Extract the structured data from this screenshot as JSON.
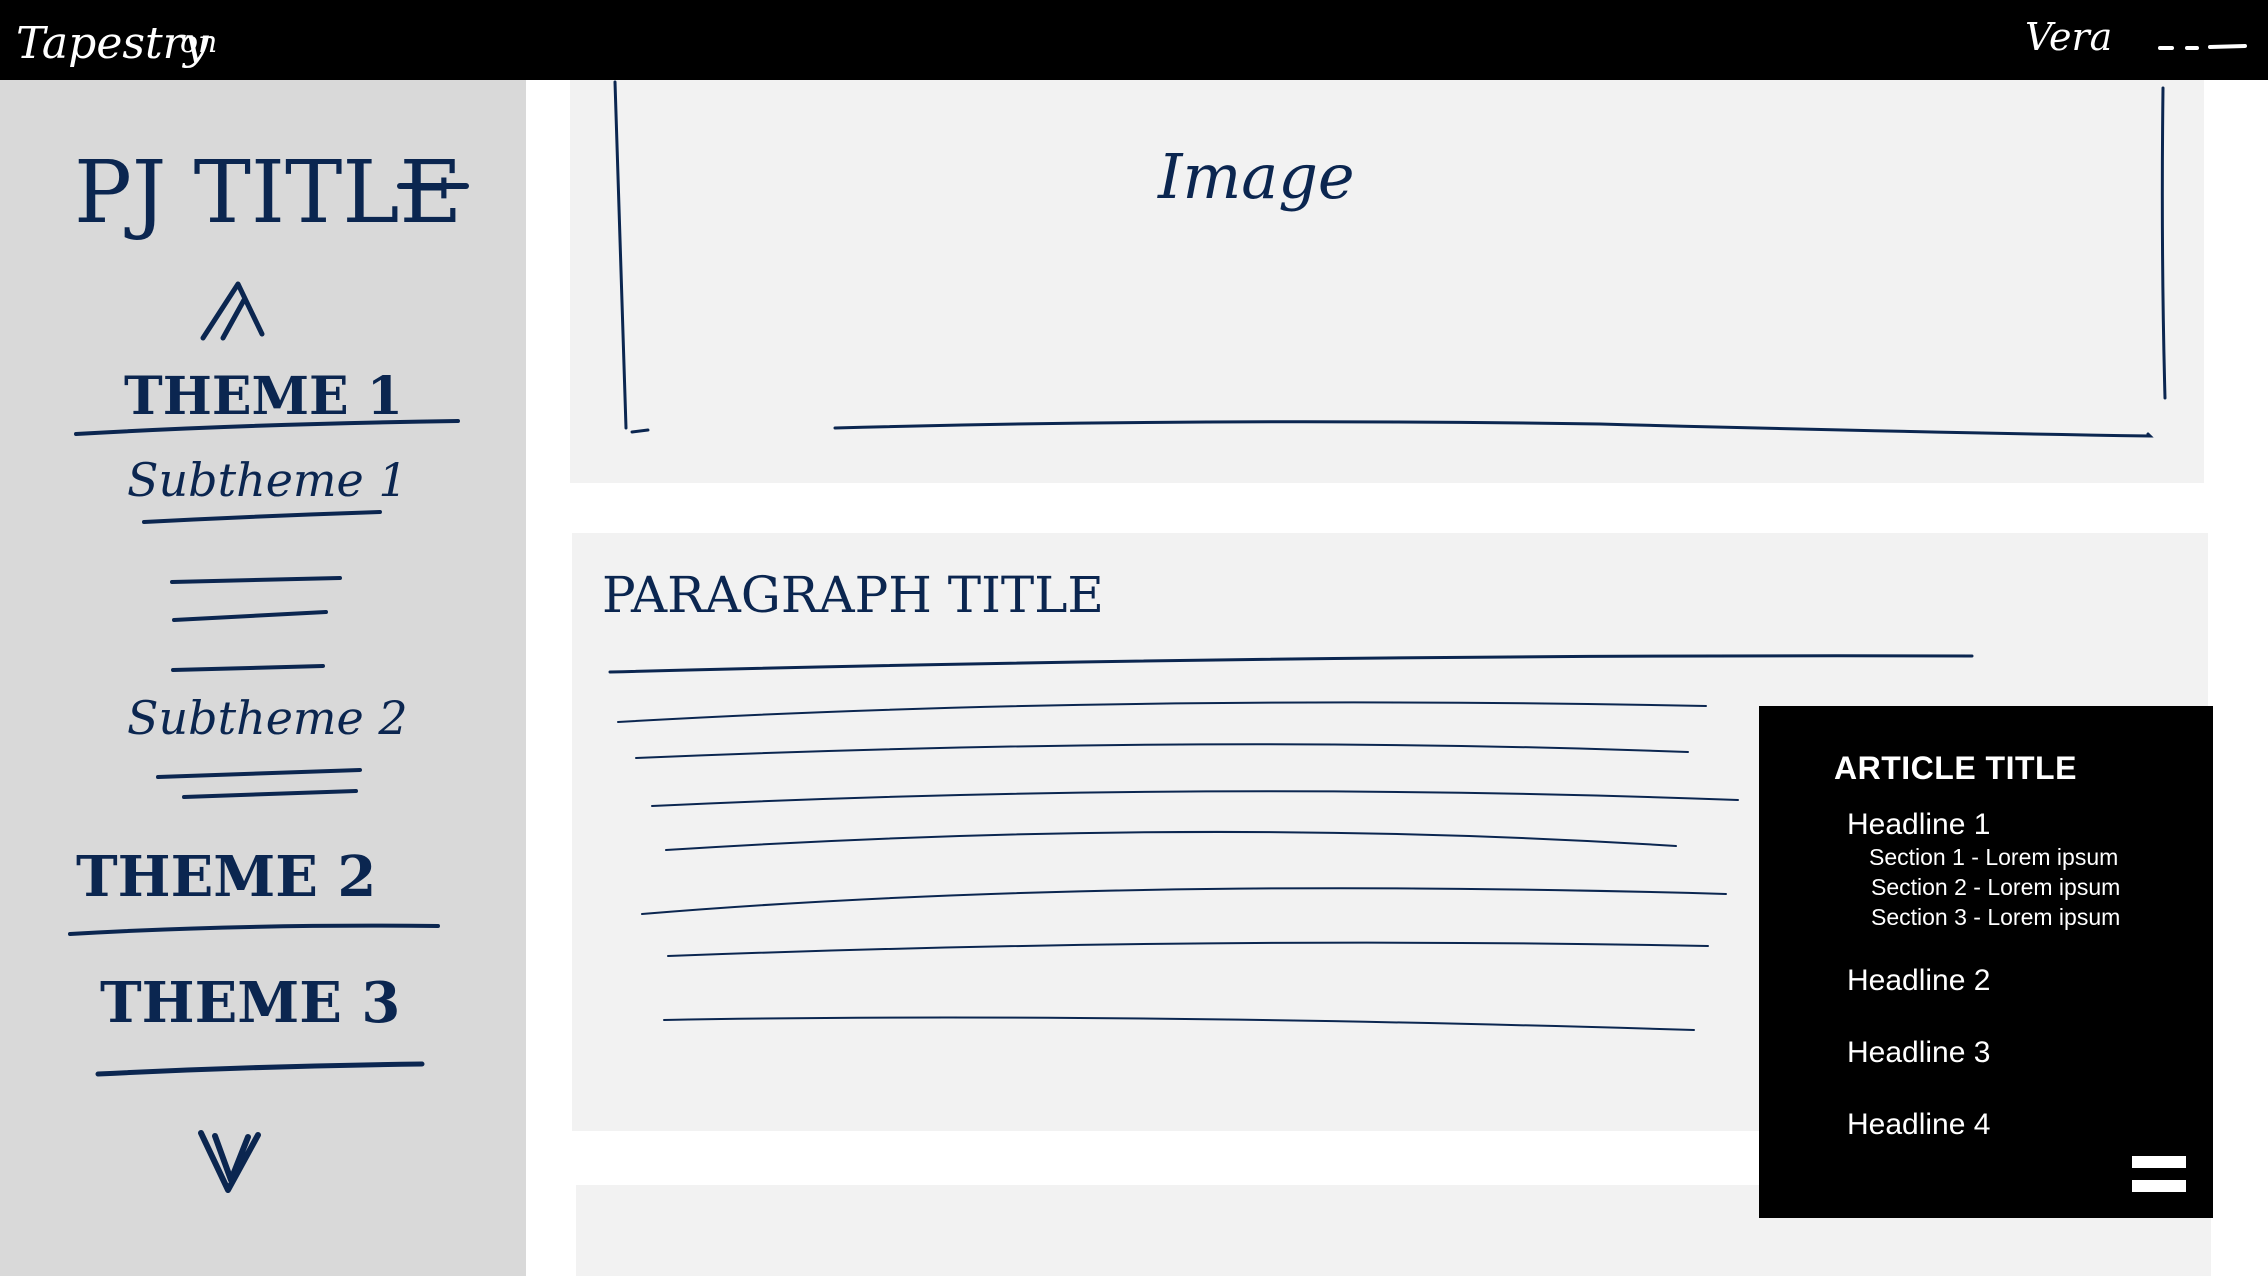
{
  "topbar": {
    "brand": "Tapestry",
    "brand_suffix": "on",
    "user_label": "Vera"
  },
  "sidebar": {
    "project_title": "PJ TITLE",
    "themes": [
      {
        "label": "THEME 1",
        "subthemes": [
          "Subtheme 1",
          "Subtheme 2"
        ]
      },
      {
        "label": "THEME 2"
      },
      {
        "label": "THEME 3"
      }
    ]
  },
  "main": {
    "image_label": "Image",
    "paragraph_title": "PARAGRAPH TITLE"
  },
  "toc": {
    "title": "ARTICLE TITLE",
    "headlines": [
      {
        "label": "Headline 1",
        "sections": [
          "Section 1 - Lorem ipsum",
          "Section 2 - Lorem ipsum",
          "Section 3 - Lorem ipsum"
        ]
      },
      {
        "label": "Headline 2"
      },
      {
        "label": "Headline 3"
      },
      {
        "label": "Headline 4"
      }
    ]
  },
  "colors": {
    "ink": "#0b2650",
    "sidebar_bg": "#d9d9d9",
    "panel_bg": "#f2f2f2",
    "bar_bg": "#000000"
  },
  "icons": {
    "up": "chevron-up-icon",
    "down": "chevron-down-icon",
    "menu": "hamburger-menu-icon"
  }
}
